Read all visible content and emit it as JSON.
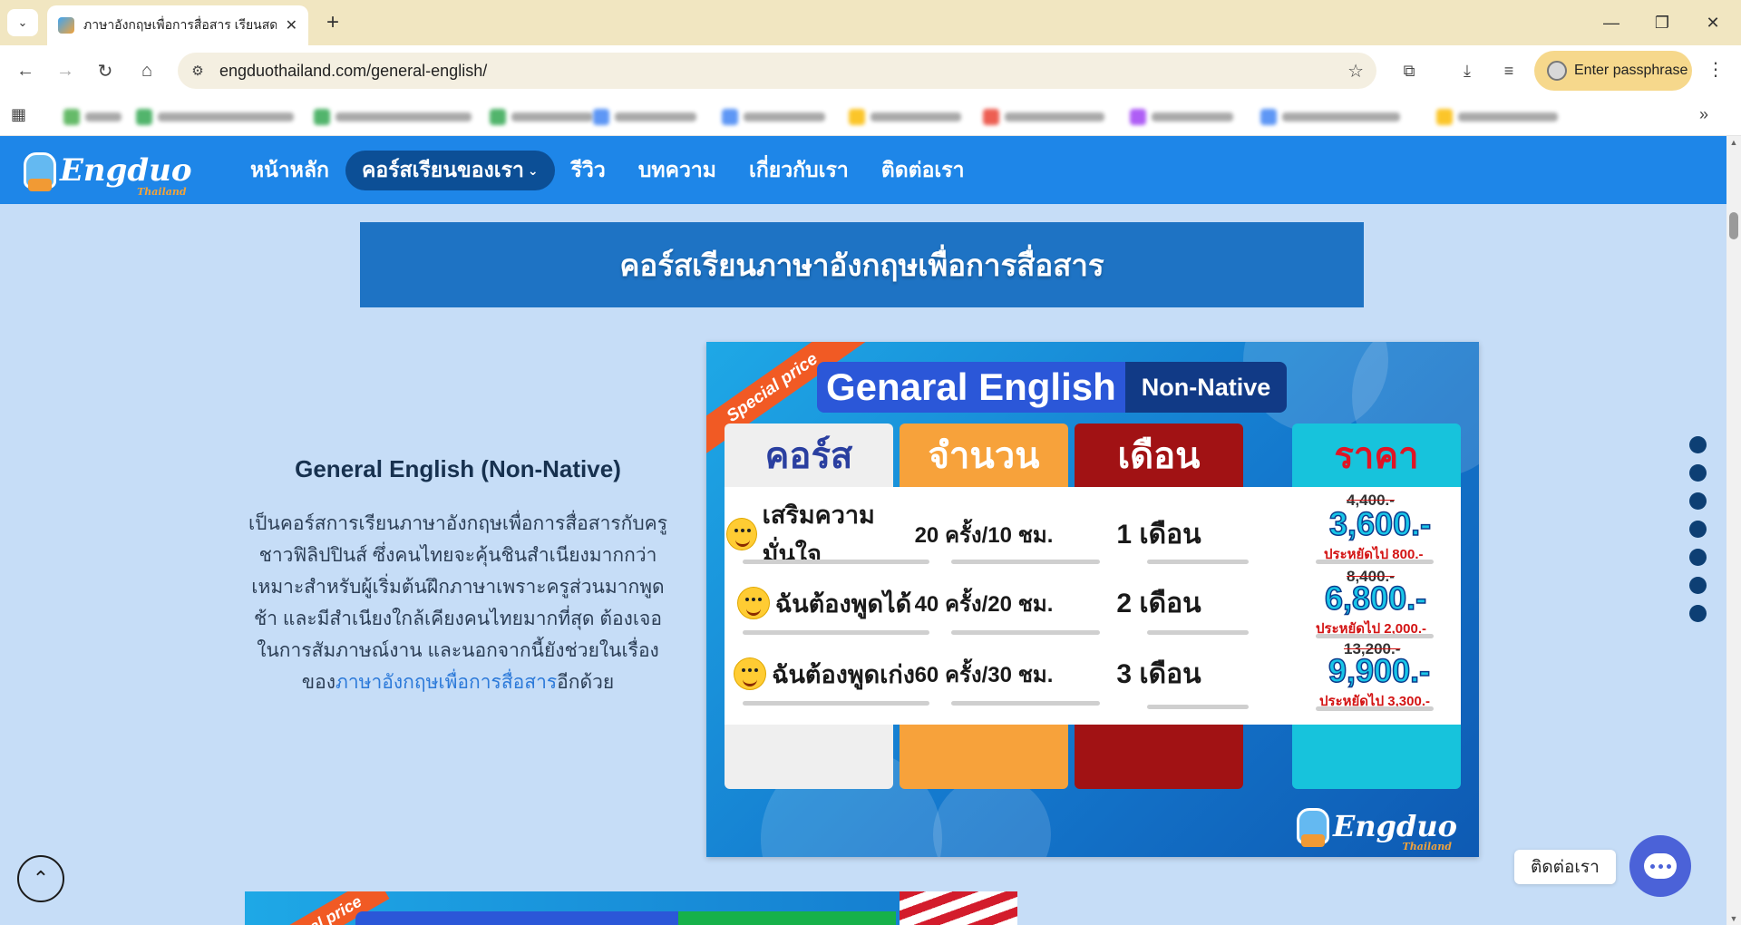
{
  "browser": {
    "tab_title": "ภาษาอังกฤษเพื่อการสื่อสาร เรียนสด",
    "url": "engduothailand.com/general-english/",
    "passphrase_label": "Enter passphrase",
    "icons": {
      "tab_menu": "chevron-down-icon",
      "new_tab": "plus-icon",
      "back": "arrow-left-icon",
      "forward": "arrow-right-icon",
      "reload": "reload-icon",
      "home": "home-icon",
      "site_info": "tune-icon",
      "bookmark": "star-icon",
      "extensions": "puzzle-icon",
      "downloads": "download-icon",
      "media": "queue-icon",
      "menu": "kebab-menu-icon"
    }
  },
  "site": {
    "logo_text": "Engduo",
    "logo_sub": "Thailand",
    "menu": [
      {
        "label": "หน้าหลัก"
      },
      {
        "label": "คอร์สเรียนของเรา"
      },
      {
        "label": "รีวิว"
      },
      {
        "label": "บทความ"
      },
      {
        "label": "เกี่ยวกับเรา"
      },
      {
        "label": "ติดต่อเรา"
      }
    ],
    "section_title": "คอร์สเรียนภาษาอังกฤษเพื่อการสื่อสาร",
    "course": {
      "title": "General English (Non-Native)",
      "description": "เป็นคอร์สการเรียนภาษาอังกฤษเพื่อการสื่อสารกับครูชาวฟิลิปปินส์ ซึ่งคนไทยจะคุ้นชินสำเนียงมากกว่า เหมาะสำหรับผู้เริ่มต้นฝึกภาษาเพราะครูส่วนมากพูดช้า และมีสำเนียงใกล้เคียงคนไทยมากที่สุด ต้องเจอในการสัมภาษณ์งาน และนอกจากนี้ยังช่วยในเรื่องของ",
      "link_text": "ภาษาอังกฤษเพื่อการสื่อสาร",
      "suffix": "อีกด้วย"
    },
    "card": {
      "ribbon": "Special price",
      "title_main": "Genaral English",
      "title_sub": "Non-Native",
      "headers": [
        "คอร์ส",
        "จำนวน",
        "เดือน",
        "ราคา"
      ],
      "rows": [
        {
          "course": "เสริมความมั่นใจ",
          "sessions": "20 ครั้ง/10 ชม.",
          "months": "1 เดือน",
          "old_price": "4,400.-",
          "price": "3,600.-",
          "save": "ประหยัดไป 800.-"
        },
        {
          "course": "ฉันต้องพูดได้",
          "sessions": "40 ครั้ง/20 ชม.",
          "months": "2 เดือน",
          "old_price": "8,400.-",
          "price": "6,800.-",
          "save": "ประหยัดไป 2,000.-"
        },
        {
          "course": "ฉันต้องพูดเก่ง",
          "sessions": "60 ครั้ง/30 ชม.",
          "months": "3 เดือน",
          "old_price": "13,200.-",
          "price": "9,900.-",
          "save": "ประหยัดไป 3,300.-"
        }
      ],
      "logo_text": "Engduo",
      "logo_sub": "Thailand"
    },
    "next_card_ribbon": "al price",
    "contact_label": "ติดต่อเรา",
    "colors": {
      "header": "#1e86e8",
      "banner": "#1e73c4",
      "page_bg": "#c6ddf7",
      "col_course": "#efefef",
      "col_sessions": "#f7a23b",
      "col_months": "#a11214",
      "col_price": "#17c3dc"
    }
  }
}
